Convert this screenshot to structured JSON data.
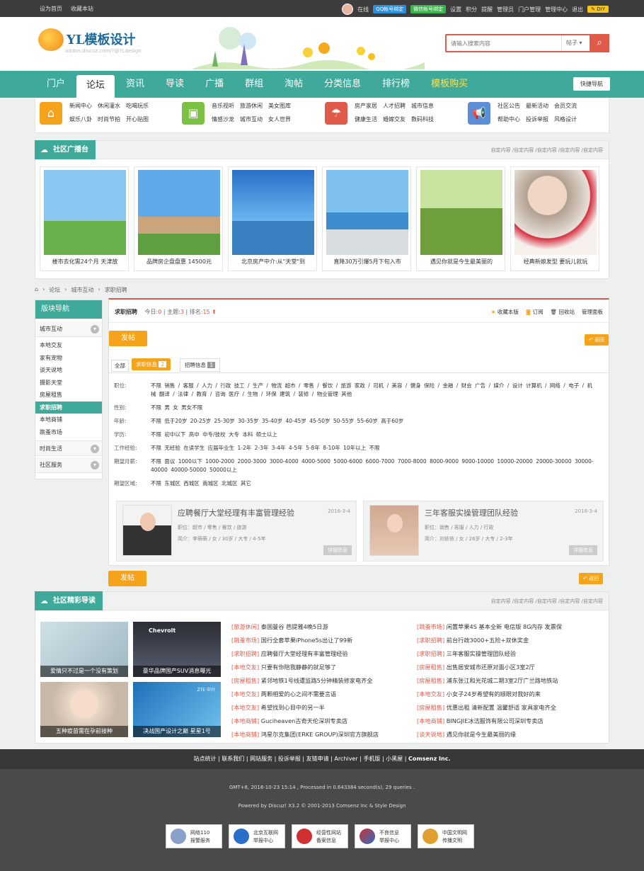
{
  "topbar": {
    "home": "设为首页",
    "favorite": "收藏本站",
    "status": "在线",
    "qq": "QQ帐号绑定",
    "wechat": "微信帐号绑定",
    "links": [
      "设置",
      "积分",
      "提醒",
      "管理员",
      "门户管理",
      "管理中心",
      "退出"
    ],
    "diy": "DIY"
  },
  "header": {
    "logo": "YL模板设计",
    "logo_sub": "addon.discuz.com/?@YLdesign",
    "search_placeholder": "请输入搜索内容",
    "search_type": "帖子"
  },
  "nav": {
    "items": [
      "门户",
      "论坛",
      "资讯",
      "导读",
      "广播",
      "群组",
      "淘帖",
      "分类信息",
      "排行榜",
      "模板购买"
    ],
    "quick": "快捷导航"
  },
  "subnav": [
    {
      "icon": "home-icon",
      "color": "#f5a31a",
      "links": [
        "新闻中心",
        "休闲灌水",
        "吃喝玩乐",
        "娱乐八卦",
        "时尚节拍",
        "开心贴图"
      ]
    },
    {
      "icon": "image-icon",
      "color": "#7bc142",
      "links": [
        "音乐视听",
        "旅游休闲",
        "美女图库",
        "情感沙龙",
        "城市互动",
        "女人世界"
      ]
    },
    {
      "icon": "umbrella-icon",
      "color": "#e05a4a",
      "links": [
        "房产家居",
        "人才招聘",
        "城市信息",
        "健康生活",
        "婚嫁交友",
        "数码科技"
      ]
    },
    {
      "icon": "megaphone-icon",
      "color": "#5b8ed6",
      "links": [
        "社区公告",
        "最新活动",
        "会员交流",
        "帮助中心",
        "投诉举报",
        "风格设计"
      ]
    }
  ],
  "broadcast": {
    "title": "社区广播台",
    "more": [
      "自定内容",
      "自定内容",
      "自定内容",
      "自定内容",
      "自定内容"
    ],
    "slides": [
      "楼市去化需24个月 天津放",
      "品牌房企盘盘惠 14500元",
      "北京房产中介:从\"天堂\"到",
      "直降30万引爆5月下旬入市",
      "遇见你就是今生最美丽的",
      "经典新娘发型 要玩儿就玩"
    ]
  },
  "crumb": [
    "论坛",
    "城市互动",
    "求职招聘"
  ],
  "sidebar": {
    "title": "版块导航",
    "cat1": "城市互动",
    "items": [
      "本地交友",
      "家有宠物",
      "谈天说地",
      "摄影天堂",
      "房屋租售",
      "求职招聘",
      "本地商铺",
      "跳蚤市场"
    ],
    "cat2": "时尚生活",
    "cat3": "社区服务"
  },
  "forum": {
    "name": "求职招聘",
    "today_label": "今日:",
    "today": "0",
    "topics_label": "主题:",
    "topics": "3",
    "rank_label": "排名:",
    "rank": "15",
    "actions": [
      "收藏本版",
      "订阅",
      "回收站",
      "管理面板"
    ],
    "post": "发帖",
    "back": "返回",
    "tabs": [
      {
        "label": "全部"
      },
      {
        "label": "求职信息",
        "count": "2"
      },
      {
        "label": "招聘信息",
        "count": "1"
      }
    ],
    "filters": [
      {
        "label": "职位:",
        "opts": "不限  销售 / 客服 / 人力 / 行政  技工 / 生产 / 物流  超市 / 零售 / 餐饮 / 旅游  家政 / 司机 / 美容 / 健身  保险 / 金融 / 财会  广告 / 媒介 / 设计  计算机 / 网络 / 电子 / 机械  翻译 / 法律 / 教育 / 咨询  医疗 / 生物 / 环保  建筑 / 装修 / 物业管理  其他"
      },
      {
        "label": "性别:",
        "opts": "不限  男  女  男女不限"
      },
      {
        "label": "年龄:",
        "opts": "不限  低于20岁  20-25岁  25-30岁  30-35岁  35-40岁  40-45岁  45-50岁  50-55岁  55-60岁  高于60岁"
      },
      {
        "label": "学历:",
        "opts": "不限  初中以下  高中  中专/技校  大专  本科  硕士以上"
      },
      {
        "label": "工作经验:",
        "opts": "不限  无经验  在读学生  应届毕业生  1-2年  2-3年  3-4年  4-5年  5-8年  8-10年  10年以上  不限"
      },
      {
        "label": "期望月薪:",
        "opts": "不限  面议  1000以下  1000-2000  2000-3000  3000-4000  4000-5000  5000-6000  6000-7000  7000-8000  8000-9000  9000-10000  10000-20000  20000-30000  30000-40000  40000-50000  50000以上"
      },
      {
        "label": "期望区域:",
        "opts": "不限  东城区  西城区  南城区  北城区  其它"
      }
    ],
    "cards": [
      {
        "title": "应聘餐厅大堂经理有丰富管理经验",
        "date": "2016-3-4",
        "job": "职位：超市 / 零售 / 餐饮 / 旅游",
        "intro": "简介：李萌萌  /  女  /  30岁  /  大专  /  4-5年",
        "btn": "详细信息"
      },
      {
        "title": "三年客服实操管理团队经验",
        "date": "2016-3-4",
        "job": "职位：销售 / 客服 / 人力 / 行政",
        "intro": "简介：刘依依  /  女  /  26岁  /  大专  /  2-3年",
        "btn": "详细信息"
      }
    ]
  },
  "guide": {
    "title": "社区精彩导读",
    "more": [
      "自定内容",
      "自定内容",
      "自定内容",
      "自定内容",
      "自定内容"
    ],
    "images": [
      "爱情只不过是一个没有策划",
      "豪华品牌国产SUV消息曝光",
      "五种疫苗需在孕前接种",
      "决战国产设计之巅 星星1号"
    ],
    "img_labels": [
      "Chevrolt",
      "ZTE 中兴"
    ],
    "col1": [
      [
        "[旅游休闲]",
        "泰国曼谷 芭提雅4晚5日游"
      ],
      [
        "[跳蚤市场]",
        "国行全套苹果iPhone5s出让了99新"
      ],
      [
        "[求职招聘]",
        "应聘餐厅大堂经理有丰富管理经验"
      ],
      [
        "[本地交友]",
        "只要有你陪我静静的就足够了"
      ],
      [
        "[房屋租售]",
        "紧邻地铁1号线遭监路5分钟精装修家电齐全"
      ],
      [
        "[本地交友]",
        "两颗相爱的心之间不需要言语"
      ],
      [
        "[本地交友]",
        "希望找到心目中的另一半"
      ],
      [
        "[本地商铺]",
        "Guciheaven古奇天伦深圳专卖店"
      ],
      [
        "[本地商铺]",
        "鸿星尔克集团(ERKE GROUP)深圳官方旗舰店"
      ]
    ],
    "col2": [
      [
        "[跳蚤市场]",
        "闲置苹果4S 基本全新 电信版 8G内存 发票保"
      ],
      [
        "[求职招聘]",
        "前台行政3000+五险+双休奖金"
      ],
      [
        "[求职招聘]",
        "三年客服实操管理团队经验"
      ],
      [
        "[房屋租售]",
        "出售居安城市还原对面小区3室2厅"
      ],
      [
        "[房屋租售]",
        "浦东张江和光花城二期3室2厅广兰路地铁站"
      ],
      [
        "[本地交友]",
        "小女子24岁希望有的顺眼对我好的来"
      ],
      [
        "[房屋租售]",
        "优惠出租 清新配置 温馨舒适 家具家电齐全"
      ],
      [
        "[本地商铺]",
        "BINGJIE冰洁服饰有限公司深圳专卖店"
      ],
      [
        "[谈天说地]",
        "遇见你就是今生最美丽的缘"
      ]
    ]
  },
  "footer": {
    "links": [
      "站点统计",
      "联系我们",
      "网站服务",
      "投诉举报",
      "友链申请",
      "Archiver",
      "手机版",
      "小黑屋",
      "Comsenz Inc."
    ],
    "time": "GMT+8, 2016-10-23 15:14 , Processed in 0.643384 second(s), 29 queries .",
    "powered": "Powered by Discuz! X3.2 © 2001-2013 Comsenz Inc & Style Design",
    "badges": [
      [
        "网络110",
        "报警服务"
      ],
      [
        "北京互联网",
        "举报中心"
      ],
      [
        "经营性网站",
        "备案信息"
      ],
      [
        "不良信息",
        "举报中心"
      ],
      [
        "中国文明网",
        "传播文明"
      ]
    ]
  }
}
